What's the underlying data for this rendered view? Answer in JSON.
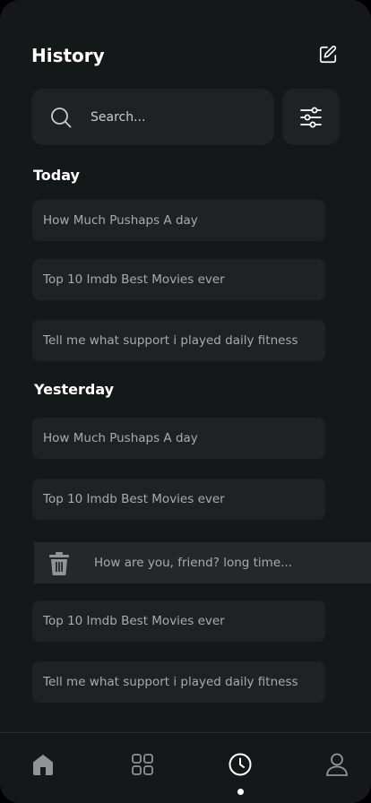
{
  "header": {
    "title": "History"
  },
  "search": {
    "placeholder": "Search..."
  },
  "sections": [
    {
      "label": "Today",
      "items": [
        "How Much Pushaps A day",
        "Top 10 Imdb Best Movies ever",
        "Tell me what support i played daily fitness"
      ]
    },
    {
      "label": "Yesterday",
      "items": [
        "How Much Pushaps A day",
        "Top 10 Imdb Best Movies ever",
        "How are you, friend? long time...",
        "Top 10 Imdb Best Movies ever",
        "Tell me what support i played daily fitness"
      ]
    }
  ],
  "nav": {
    "items": [
      {
        "icon": "home-icon"
      },
      {
        "icon": "grid-icon"
      },
      {
        "icon": "clock-icon",
        "active": true
      },
      {
        "icon": "user-icon"
      }
    ]
  },
  "colors": {
    "background": "#151819",
    "card": "#1f2223",
    "text": "#a6abad",
    "icon": "#8f9497"
  }
}
